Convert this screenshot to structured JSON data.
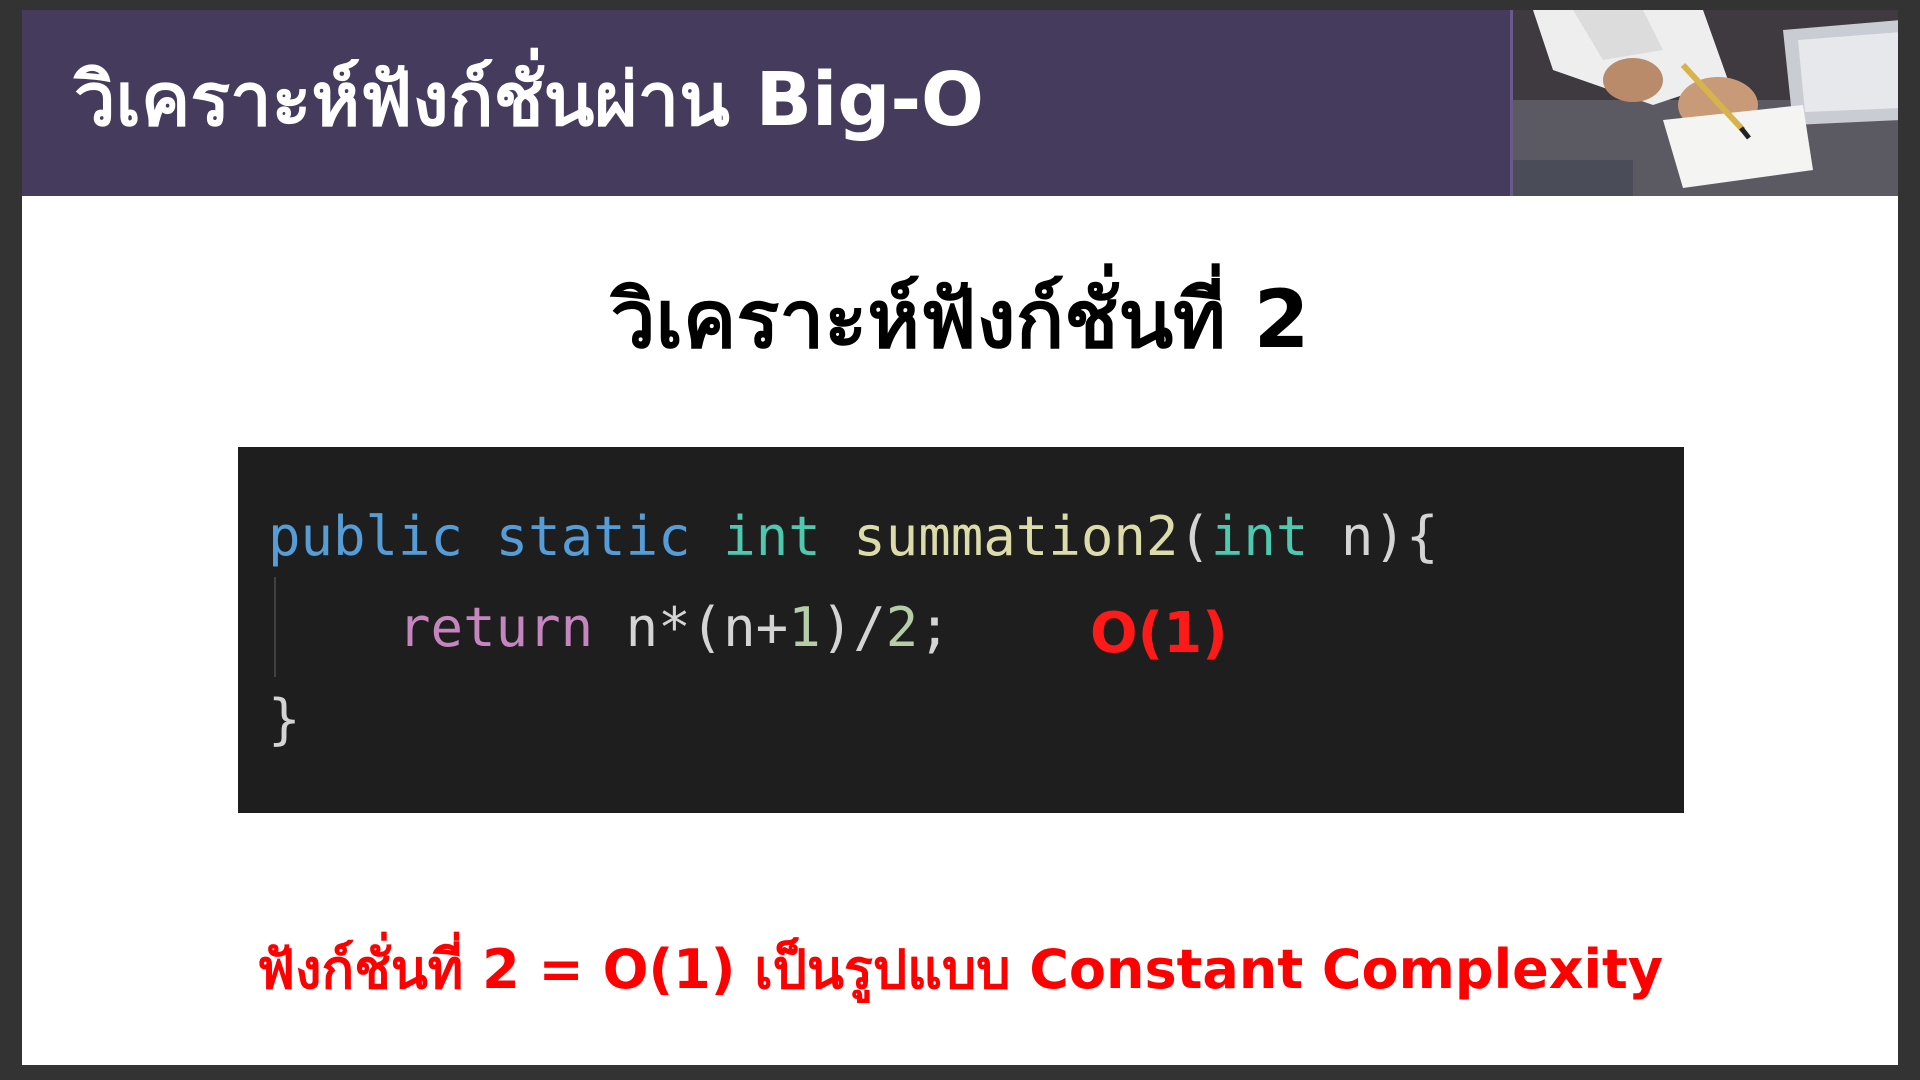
{
  "header": {
    "title": "วิเคราะห์ฟังก์ชั่นผ่าน Big-O",
    "photo_description_icon": "person-writing-photo"
  },
  "slide": {
    "heading": "วิเคราะห์ฟังก์ชั่นที่ 2"
  },
  "code": {
    "line1": {
      "public": "public",
      "static": "static",
      "int": "int",
      "name": "summation2",
      "open_paren": "(",
      "param_type": "int",
      "param_rest": " n){"
    },
    "line2": {
      "indent": "    ",
      "return": "return",
      "expr_a": " n*(n+",
      "one": "1",
      "expr_b": ")/",
      "two": "2",
      "expr_c": ";"
    },
    "line3": "}",
    "annotation": "O(1)"
  },
  "conclusion": "ฟังก์ชั่นที่ 2 = O(1) เป็นรูปแบบ Constant Complexity",
  "colors": {
    "header_bg": "#453b5c",
    "code_bg": "#1e1e1e",
    "accent_red": "#ff0000",
    "keyword": "#569cd6",
    "type": "#4ec9b0",
    "control": "#c586c0",
    "function": "#dcdcaa"
  }
}
